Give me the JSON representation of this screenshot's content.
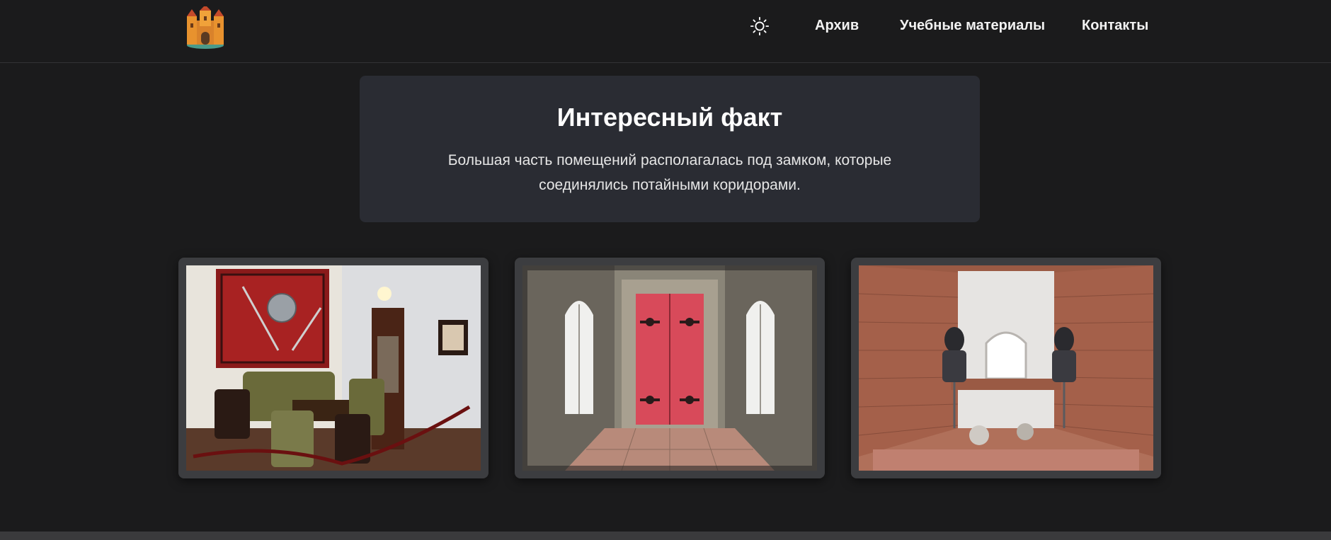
{
  "header": {
    "logo": "castle-logo-icon",
    "theme_toggle": "sun-icon",
    "nav": [
      {
        "label": "Архив"
      },
      {
        "label": "Учебные материалы"
      },
      {
        "label": "Контакты"
      }
    ]
  },
  "fact": {
    "title": "Интересный факт",
    "text": "Большая часть помещений располагалась под замком, которые соединялись потайными коридорами."
  },
  "gallery": [
    {
      "name": "castle-room-photo"
    },
    {
      "name": "red-door-corridor-photo"
    },
    {
      "name": "armor-room-photo"
    }
  ],
  "colors": {
    "background": "#1b1b1c",
    "card": "#2a2c33",
    "frame": "#3c3d40"
  }
}
